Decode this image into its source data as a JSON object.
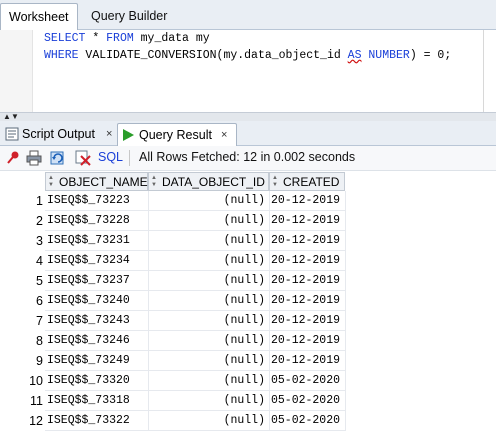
{
  "top_tabs": {
    "worksheet": "Worksheet",
    "query_builder": "Query Builder"
  },
  "editor": {
    "line1": {
      "k1": "SELECT",
      "t1": " * ",
      "k2": "FROM",
      "t2": " my_data my"
    },
    "line2": {
      "k1": "WHERE",
      "t1": " VALIDATE_CONVERSION(my.data_object_id ",
      "k2": "AS",
      "t2": " ",
      "k3": "NUMBER",
      "t3": ") = 0;"
    }
  },
  "bottom_tabs": {
    "script_output": "Script Output",
    "query_result": "Query Result",
    "close": "×"
  },
  "toolbar": {
    "sql_label": "SQL",
    "status": "All Rows Fetched: 12 in 0.002 seconds"
  },
  "grid": {
    "columns": [
      "OBJECT_NAME",
      "DATA_OBJECT_ID",
      "CREATED"
    ],
    "rows": [
      {
        "n": "1",
        "name": "ISEQ$$_73223",
        "id": "(null)",
        "created": "20-12-2019"
      },
      {
        "n": "2",
        "name": "ISEQ$$_73228",
        "id": "(null)",
        "created": "20-12-2019"
      },
      {
        "n": "3",
        "name": "ISEQ$$_73231",
        "id": "(null)",
        "created": "20-12-2019"
      },
      {
        "n": "4",
        "name": "ISEQ$$_73234",
        "id": "(null)",
        "created": "20-12-2019"
      },
      {
        "n": "5",
        "name": "ISEQ$$_73237",
        "id": "(null)",
        "created": "20-12-2019"
      },
      {
        "n": "6",
        "name": "ISEQ$$_73240",
        "id": "(null)",
        "created": "20-12-2019"
      },
      {
        "n": "7",
        "name": "ISEQ$$_73243",
        "id": "(null)",
        "created": "20-12-2019"
      },
      {
        "n": "8",
        "name": "ISEQ$$_73246",
        "id": "(null)",
        "created": "20-12-2019"
      },
      {
        "n": "9",
        "name": "ISEQ$$_73249",
        "id": "(null)",
        "created": "20-12-2019"
      },
      {
        "n": "10",
        "name": "ISEQ$$_73320",
        "id": "(null)",
        "created": "05-02-2020"
      },
      {
        "n": "11",
        "name": "ISEQ$$_73318",
        "id": "(null)",
        "created": "05-02-2020"
      },
      {
        "n": "12",
        "name": "ISEQ$$_73322",
        "id": "(null)",
        "created": "05-02-2020"
      }
    ]
  },
  "icons": {
    "pin": "pin-icon",
    "print": "print-icon",
    "refresh": "refresh-icon",
    "delete": "delete-icon",
    "script_output": "script-output-icon",
    "query_result": "run-icon"
  },
  "colors": {
    "keyword": "#1a3fd8",
    "tab_bar": "#e9eef4",
    "run_green": "#2a9d2a",
    "pin_red": "#d0202a"
  }
}
